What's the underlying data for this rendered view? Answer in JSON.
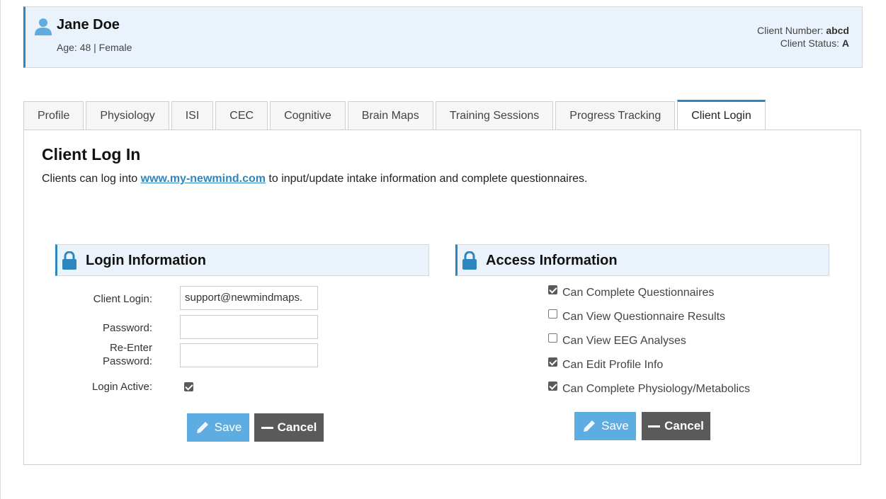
{
  "client": {
    "name": "Jane Doe",
    "age_gender": "Age: 48 | Female",
    "number_label": "Client Number:",
    "number_value": "abcd",
    "status_label": "Client Status:",
    "status_value": "A"
  },
  "tabs": [
    {
      "label": "Profile",
      "active": false
    },
    {
      "label": "Physiology",
      "active": false
    },
    {
      "label": "ISI",
      "active": false
    },
    {
      "label": "CEC",
      "active": false
    },
    {
      "label": "Cognitive",
      "active": false
    },
    {
      "label": "Brain Maps",
      "active": false
    },
    {
      "label": "Training Sessions",
      "active": false
    },
    {
      "label": "Progress Tracking",
      "active": false
    },
    {
      "label": "Client Login",
      "active": true
    }
  ],
  "panel": {
    "title": "Client Log In",
    "desc_before": "Clients can log into ",
    "desc_link": "www.my-newmind.com",
    "desc_after": " to input/update intake information and complete questionnaires."
  },
  "login": {
    "title": "Login Information",
    "client_login_label": "Client Login:",
    "client_login_value": "support@newmindmaps.",
    "password_label": "Password:",
    "password_value": "",
    "reenter_label_1": "Re-Enter",
    "reenter_label_2": "Password:",
    "reenter_value": "",
    "active_label": "Login Active:",
    "active_checked": true,
    "save_label": "Save",
    "cancel_label": "Cancel"
  },
  "access": {
    "title": "Access Information",
    "items": [
      {
        "label": "Can Complete Questionnaires",
        "checked": true
      },
      {
        "label": "Can View Questionnaire Results",
        "checked": false
      },
      {
        "label": "Can View EEG Analyses",
        "checked": false
      },
      {
        "label": "Can Edit Profile Info",
        "checked": true
      },
      {
        "label": "Can Complete Physiology/Metabolics",
        "checked": true
      }
    ],
    "save_label": "Save",
    "cancel_label": "Cancel"
  },
  "colors": {
    "accent": "#2e86c1",
    "header_bg": "#eaf3fb",
    "save_btn": "#5dade2",
    "cancel_btn": "#5a5a5a"
  }
}
